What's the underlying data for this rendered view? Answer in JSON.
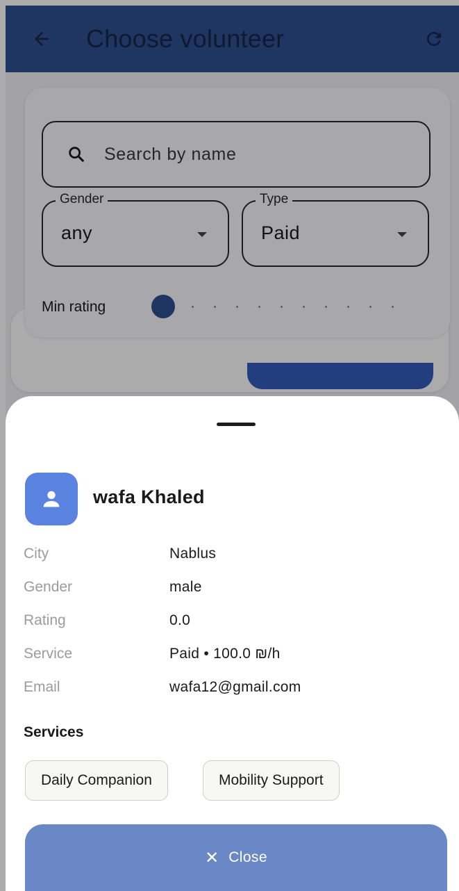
{
  "appbar": {
    "title": "Choose volunteer",
    "back_icon": "arrow-left-icon",
    "refresh_icon": "refresh-icon",
    "background": "#2f4f93"
  },
  "filters": {
    "search_placeholder": "Search by name",
    "gender": {
      "label": "Gender",
      "value": "any"
    },
    "type": {
      "label": "Type",
      "value": "Paid"
    },
    "min_rating_label": "Min rating",
    "min_rating_value": 0
  },
  "sheet": {
    "name": "wafa Khaled",
    "avatar_icon": "person-icon",
    "details": [
      {
        "key": "City",
        "value": "Nablus"
      },
      {
        "key": "Gender",
        "value": "male"
      },
      {
        "key": "Rating",
        "value": "0.0"
      },
      {
        "key": "Service",
        "value": "Paid • 100.0 ₪/h"
      },
      {
        "key": "Email",
        "value": "wafa12@gmail.com"
      }
    ],
    "services_title": "Services",
    "services": [
      "Daily Companion",
      "Mobility Support"
    ],
    "close_label": "Close",
    "close_icon": "close-icon"
  },
  "colors": {
    "accent": "#345dbd",
    "avatar": "#5a83e0",
    "close_button": "#6a87c6"
  }
}
